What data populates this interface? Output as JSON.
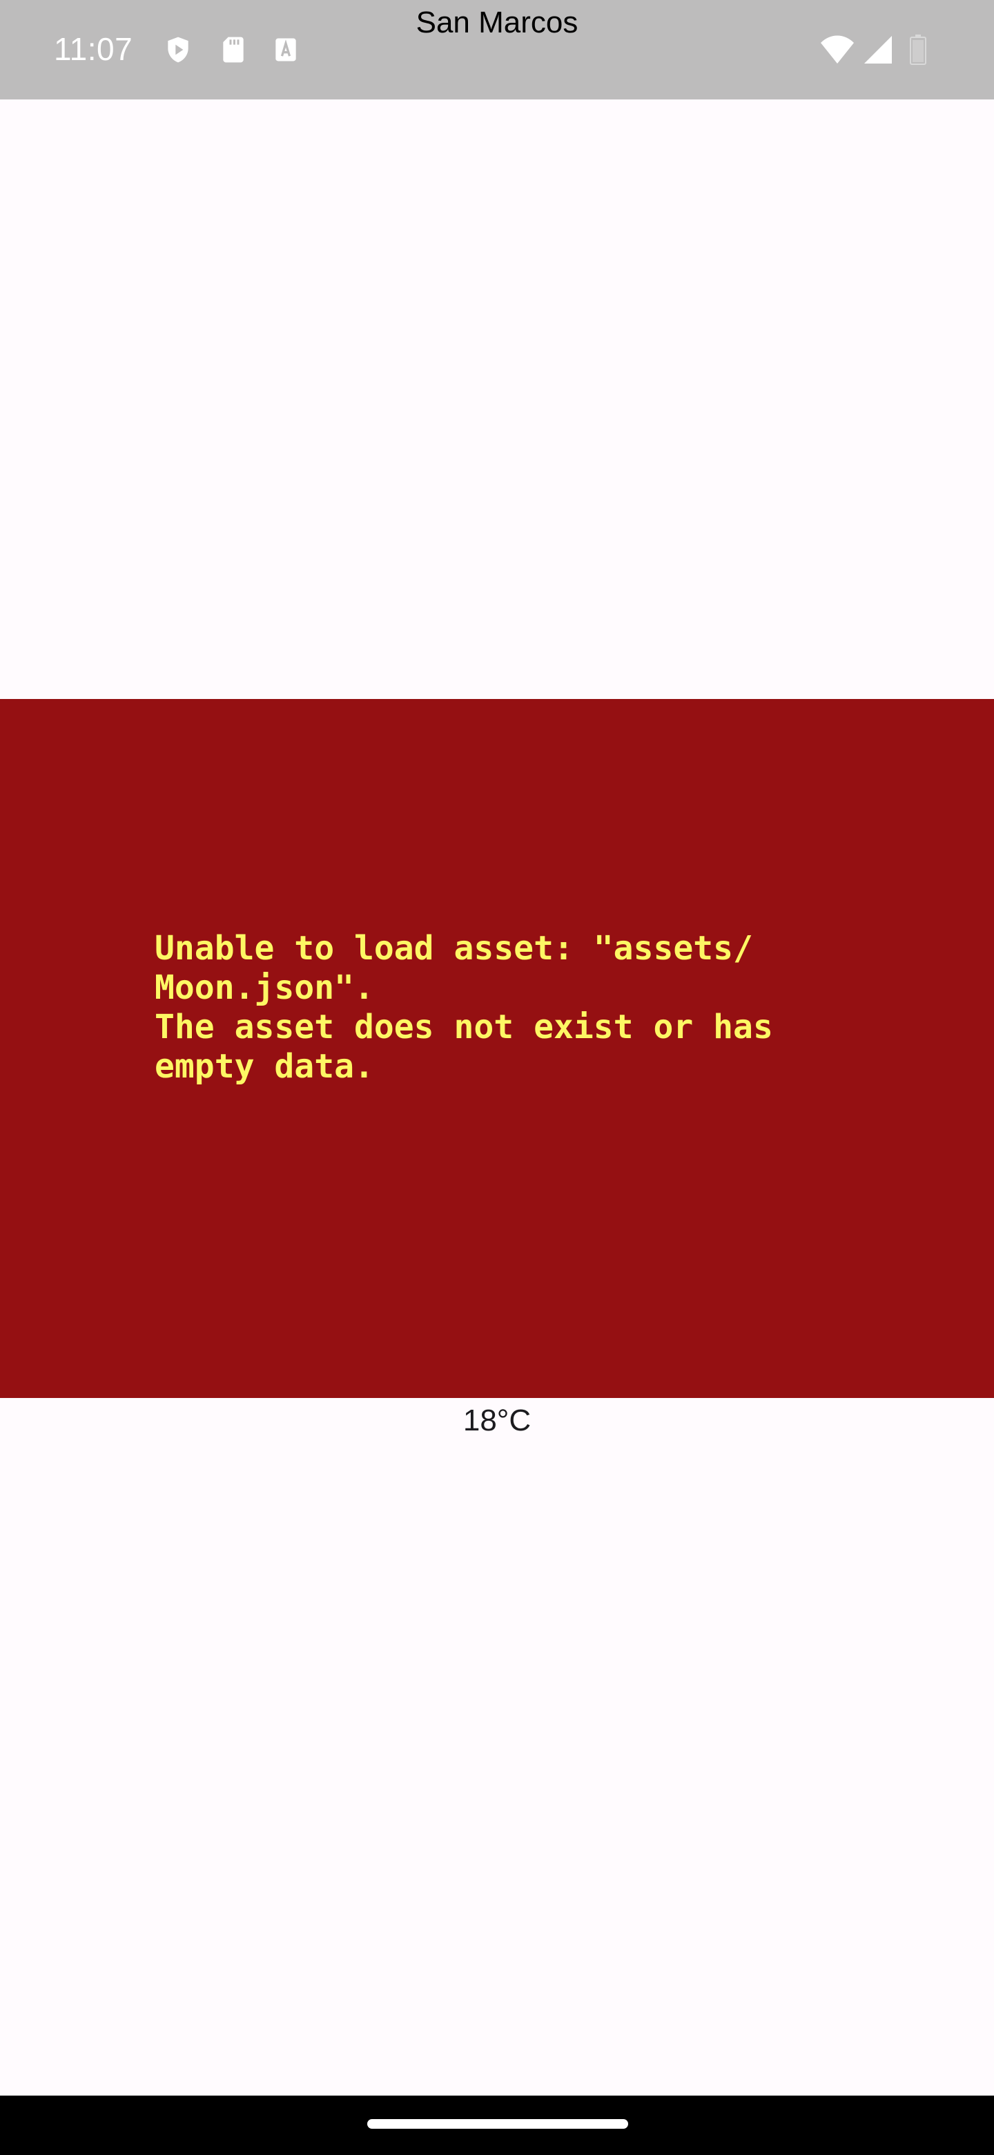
{
  "status_bar": {
    "time": "11:07",
    "icons": [
      "play-protect-icon",
      "sd-card-icon",
      "keyboard-a-icon",
      "wifi-icon",
      "signal-icon",
      "battery-icon"
    ]
  },
  "header": {
    "title": "San Marcos"
  },
  "error": {
    "message": "Unable to load asset: \"assets/\nMoon.json\".\nThe asset does not exist or has\nempty data.",
    "background_color": "#951012",
    "text_color": "#fdf764"
  },
  "weather": {
    "temperature": "18°C"
  }
}
